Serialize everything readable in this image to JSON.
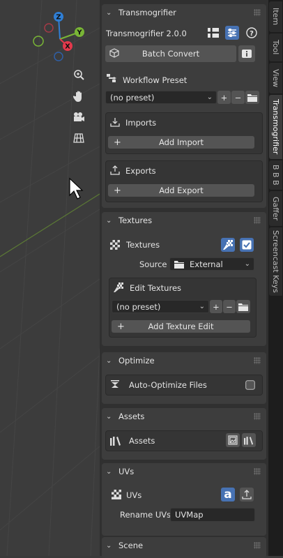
{
  "viewport": {
    "gizmo": {
      "z": "Z",
      "y": "Y",
      "x": "X"
    },
    "nav_tools": [
      "zoom-icon",
      "hand-icon",
      "camera-icon",
      "grid-icon"
    ]
  },
  "sidebar": {
    "transmogrifier_panel": {
      "title": "Transmogrifier",
      "version": "Transmogrifier 2.0.0",
      "batch_convert": "Batch Convert",
      "workflow_label": "Workflow Preset",
      "workflow_value": "(no preset)",
      "imports_label": "Imports",
      "add_import": "Add Import",
      "exports_label": "Exports",
      "add_export": "Add Export"
    },
    "textures_panel": {
      "title": "Textures",
      "textures_label": "Textures",
      "source_label": "Source",
      "source_value": "External",
      "edit_textures_label": "Edit Textures",
      "edit_preset_value": "(no preset)",
      "add_texture_edit": "Add Texture Edit"
    },
    "optimize_panel": {
      "title": "Optimize",
      "auto_optimize_label": "Auto-Optimize Files"
    },
    "assets_panel": {
      "title": "Assets",
      "assets_label": "Assets"
    },
    "uvs_panel": {
      "title": "UVs",
      "uvs_label": "UVs",
      "rename_label": "Rename UVs",
      "rename_value": "UVMap"
    },
    "scene_panel": {
      "title": "Scene"
    }
  },
  "tabs": [
    "Item",
    "Tool",
    "View",
    "Transmogrifier",
    "B B B",
    "Gaffer",
    "Screencast Keys"
  ],
  "colors": {
    "accent": "#4772b3",
    "x_axis": "#e5394c",
    "y_axis": "#79b536",
    "z_axis": "#2f7fd6"
  }
}
